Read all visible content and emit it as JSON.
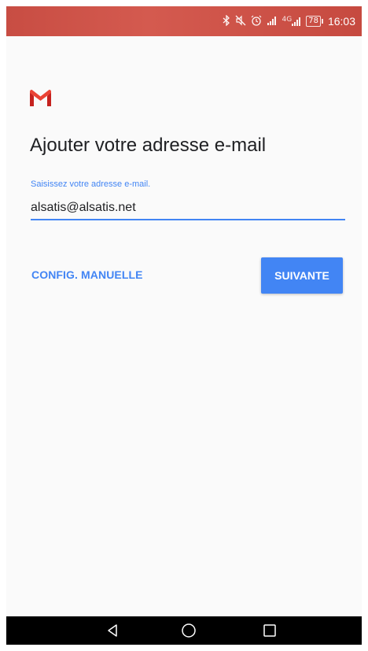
{
  "status_bar": {
    "icons": [
      "bluetooth-icon",
      "mute-icon",
      "alarm-icon",
      "signal-icon",
      "signal-4g-icon",
      "battery-icon"
    ],
    "network_label": "4G",
    "battery_level": "78",
    "time": "16:03",
    "color": "#c84d43"
  },
  "app": {
    "logo_icon": "gmail-logo-icon",
    "heading": "Ajouter votre adresse e-mail",
    "email_field": {
      "label": "Saisissez votre adresse e-mail.",
      "value": "alsatis@alsatis.net"
    },
    "buttons": {
      "manual_config": "CONFIG. MANUELLE",
      "next": "SUIVANTE"
    },
    "accent_color": "#4285f4"
  },
  "nav_bar": {
    "buttons": [
      "back-icon",
      "home-icon",
      "recent-apps-icon"
    ]
  }
}
